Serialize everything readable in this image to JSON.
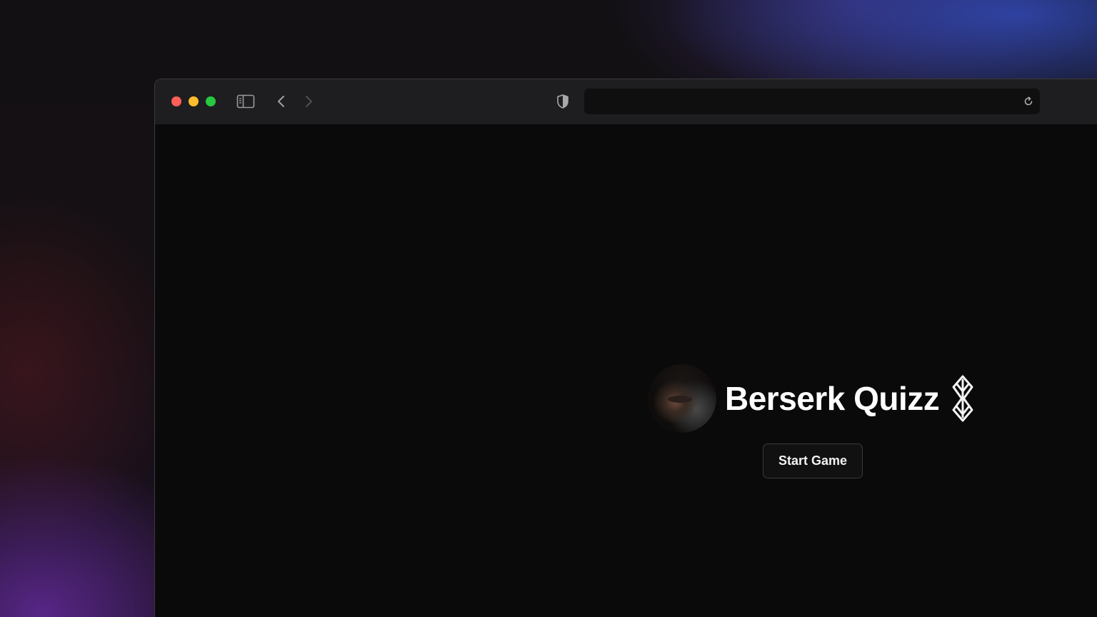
{
  "browser": {
    "address_text": "",
    "icons": {
      "close": "close-dot-icon",
      "minimize": "minimize-dot-icon",
      "zoom": "zoom-dot-icon",
      "sidebar": "sidebar-toggle-icon",
      "back": "chevron-left-icon",
      "forward": "chevron-right-icon",
      "privacy": "shield-icon",
      "reload": "reload-icon"
    },
    "colors": {
      "close": "#fe5f57",
      "minimize": "#febc2e",
      "zoom": "#28c840"
    }
  },
  "hero": {
    "title": "Berserk Quizz",
    "avatar": "guts-portrait-image",
    "brand_icon": "brand-of-sacrifice-icon"
  },
  "actions": {
    "start_label": "Start Game"
  }
}
